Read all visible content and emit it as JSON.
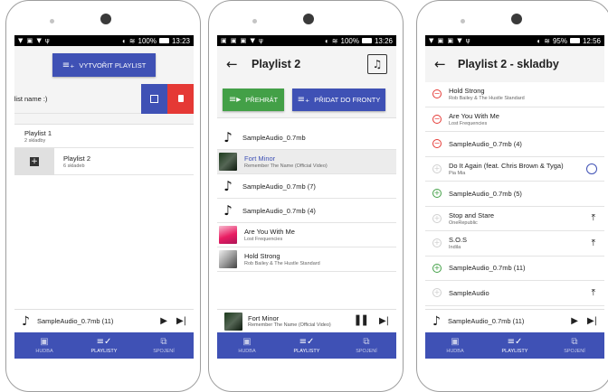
{
  "colors": {
    "primary": "#3f51b5",
    "green": "#43a047",
    "red": "#e53935",
    "status_bar": "#000000"
  },
  "bottom_nav": [
    {
      "label": "HUDBA",
      "icon": "music-library-icon"
    },
    {
      "label": "PLAYLISTY",
      "icon": "playlist-check-icon"
    },
    {
      "label": "SPOJENÍ",
      "icon": "cast-icon"
    }
  ],
  "screen1": {
    "status": {
      "battery": "100%",
      "time": "13:23"
    },
    "create_playlist_button": "VYTVOŘIT PLAYLIST",
    "name_input": "ylist name :)",
    "playlists": [
      {
        "name": "Playlist 1",
        "count": "2 skladby"
      },
      {
        "name": "Playlist 2",
        "count": "6 skladeb"
      }
    ],
    "player": {
      "track": "SampleAudio_0.7mb (11)"
    }
  },
  "screen2": {
    "status": {
      "battery": "100%",
      "time": "13:26"
    },
    "title": "Playlist 2",
    "play_button": "PŘEHRÁT",
    "add_queue_button": "PŘIDAT DO FRONTY",
    "tracks": [
      {
        "title": "SampleAudio_0.7mb",
        "subtitle": "",
        "art": "note"
      },
      {
        "title": "Fort Minor",
        "subtitle": "Remember The Name (Official Video)",
        "art": "fort"
      },
      {
        "title": "SampleAudio_0.7mb (7)",
        "subtitle": "",
        "art": "note"
      },
      {
        "title": "SampleAudio_0.7mb (4)",
        "subtitle": "",
        "art": "note"
      },
      {
        "title": "Are You With Me",
        "subtitle": "Lost Frequencies",
        "art": "pink"
      },
      {
        "title": "Hold Strong",
        "subtitle": "Rob Bailey & The Hustle Standard",
        "art": "hold"
      }
    ],
    "player": {
      "title": "Fort Minor",
      "subtitle": "Remember The Name (Official Video)"
    }
  },
  "screen3": {
    "status": {
      "battery": "95%",
      "time": "12:56"
    },
    "title": "Playlist 2 - skladby",
    "tracks": [
      {
        "title": "Hold Strong",
        "subtitle": "Rob Bailey & The Hustle Standard",
        "state": "remove",
        "extra": ""
      },
      {
        "title": "Are You With Me",
        "subtitle": "Lost Frequencies",
        "state": "remove",
        "extra": ""
      },
      {
        "title": "SampleAudio_0.7mb (4)",
        "subtitle": "",
        "state": "remove",
        "extra": ""
      },
      {
        "title": "Do It Again (feat. Chris Brown & Tyga)",
        "subtitle": "Pia Mia",
        "state": "add-muted",
        "extra": "ring"
      },
      {
        "title": "SampleAudio_0.7mb (5)",
        "subtitle": "",
        "state": "add",
        "extra": ""
      },
      {
        "title": "Stop and Stare",
        "subtitle": "OneRepublic",
        "state": "add-muted",
        "extra": "upload"
      },
      {
        "title": "S.O.S",
        "subtitle": "Indila",
        "state": "add-muted",
        "extra": "upload"
      },
      {
        "title": "SampleAudio_0.7mb (11)",
        "subtitle": "",
        "state": "add",
        "extra": ""
      },
      {
        "title": "SampleAudio",
        "subtitle": "",
        "state": "add-muted",
        "extra": "upload"
      }
    ],
    "player": {
      "track": "SampleAudio_0.7mb (11)"
    }
  }
}
